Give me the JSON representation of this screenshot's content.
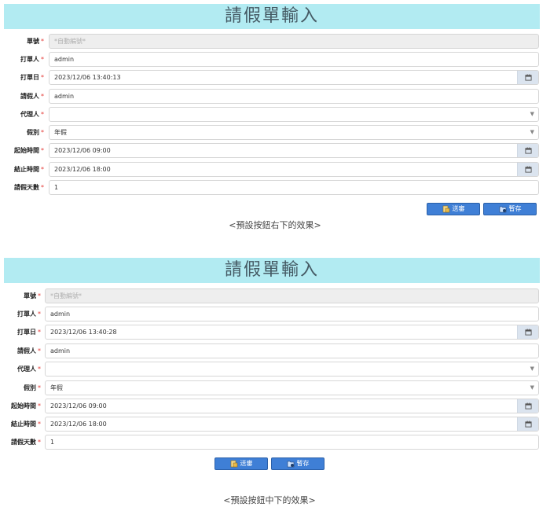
{
  "forms": [
    {
      "title": "請假單輸入",
      "fields": {
        "doc_no": {
          "label": "單號",
          "required": "*",
          "placeholder": "*自動編號*"
        },
        "creator": {
          "label": "打單人",
          "required": "*",
          "value": "admin"
        },
        "create_date": {
          "label": "打單日",
          "required": "*",
          "value": "2023/12/06 13:40:13"
        },
        "applicant": {
          "label": "請假人",
          "required": "*",
          "value": "admin"
        },
        "deputy": {
          "label": "代理人",
          "required": "*",
          "value": ""
        },
        "leave_type": {
          "label": "假別",
          "required": "*",
          "value": "年假"
        },
        "start_time": {
          "label": "起始時間",
          "required": "*",
          "value": "2023/12/06 09:00"
        },
        "end_time": {
          "label": "結止時間",
          "required": "*",
          "value": "2023/12/06 18:00"
        },
        "days": {
          "label": "請假天數",
          "required": "*",
          "value": "1"
        }
      },
      "buttons": {
        "submit": "送審",
        "save": "暫存"
      },
      "caption": "<預設按鈕右下的效果>"
    },
    {
      "title": "請假單輸入",
      "fields": {
        "doc_no": {
          "label": "單號",
          "required": "*",
          "placeholder": "*自動編號*"
        },
        "creator": {
          "label": "打單人",
          "required": "*",
          "value": "admin"
        },
        "create_date": {
          "label": "打單日",
          "required": "*",
          "value": "2023/12/06 13:40:28"
        },
        "applicant": {
          "label": "請假人",
          "required": "*",
          "value": "admin"
        },
        "deputy": {
          "label": "代理人",
          "required": "*",
          "value": ""
        },
        "leave_type": {
          "label": "假別",
          "required": "*",
          "value": "年假"
        },
        "start_time": {
          "label": "起始時間",
          "required": "*",
          "value": "2023/12/06 09:00"
        },
        "end_time": {
          "label": "結止時間",
          "required": "*",
          "value": "2023/12/06 18:00"
        },
        "days": {
          "label": "請假天數",
          "required": "*",
          "value": "1"
        }
      },
      "buttons": {
        "submit": "送審",
        "save": "暫存"
      },
      "caption": "<預設按鈕中下的效果>"
    }
  ],
  "icons": {
    "calendar": "calendar-icon",
    "dropdown": "dropdown-caret-icon",
    "submit": "send-review-icon",
    "save": "save-draft-icon"
  },
  "colors": {
    "title_bg": "#b2ebf2",
    "button": "#3f7fd6",
    "required": "#e53935"
  }
}
